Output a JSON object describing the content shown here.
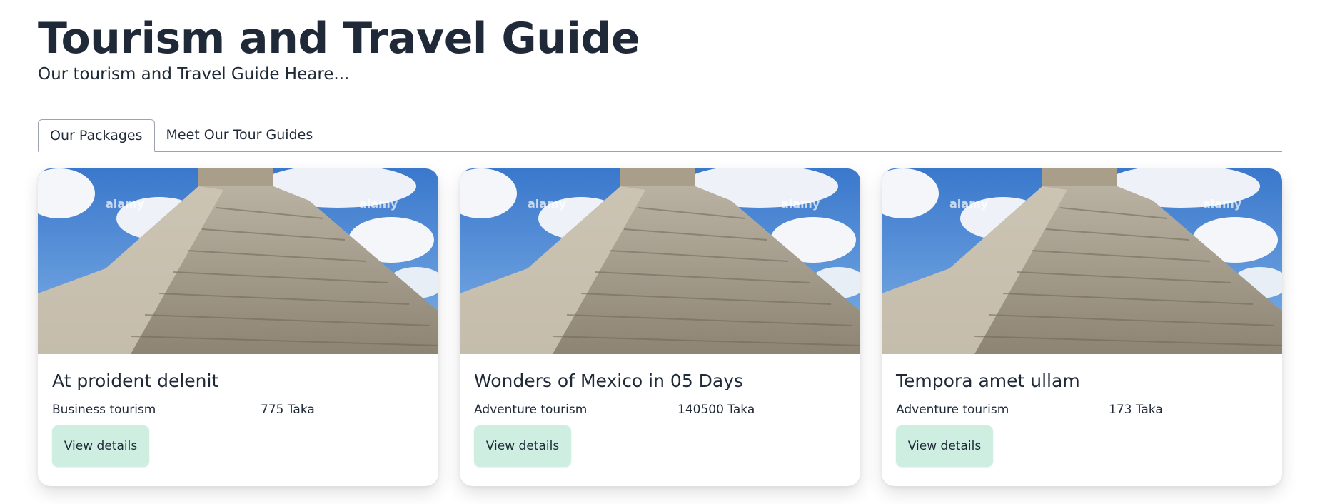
{
  "hero": {
    "title": "Tourism and Travel Guide",
    "subtitle": "Our tourism and Travel Guide Heare..."
  },
  "tabs": [
    {
      "label": "Our Packages",
      "active": true
    },
    {
      "label": "Meet Our Tour Guides",
      "active": false
    }
  ],
  "packages": [
    {
      "title": "At proident delenit",
      "type": "Business tourism",
      "price": "775 Taka",
      "button_label": "View details",
      "image_watermark": "alamy"
    },
    {
      "title": "Wonders of Mexico in 05 Days",
      "type": "Adventure tourism",
      "price": "140500 Taka",
      "button_label": "View details",
      "image_watermark": "alamy"
    },
    {
      "title": "Tempora amet ullam",
      "type": "Adventure tourism",
      "price": "173 Taka",
      "button_label": "View details",
      "image_watermark": "alamy"
    }
  ],
  "colors": {
    "text": "#1f2937",
    "button_bg": "#cdeee0",
    "tab_border": "#9ca3af",
    "sky": "#3f7fd0"
  }
}
